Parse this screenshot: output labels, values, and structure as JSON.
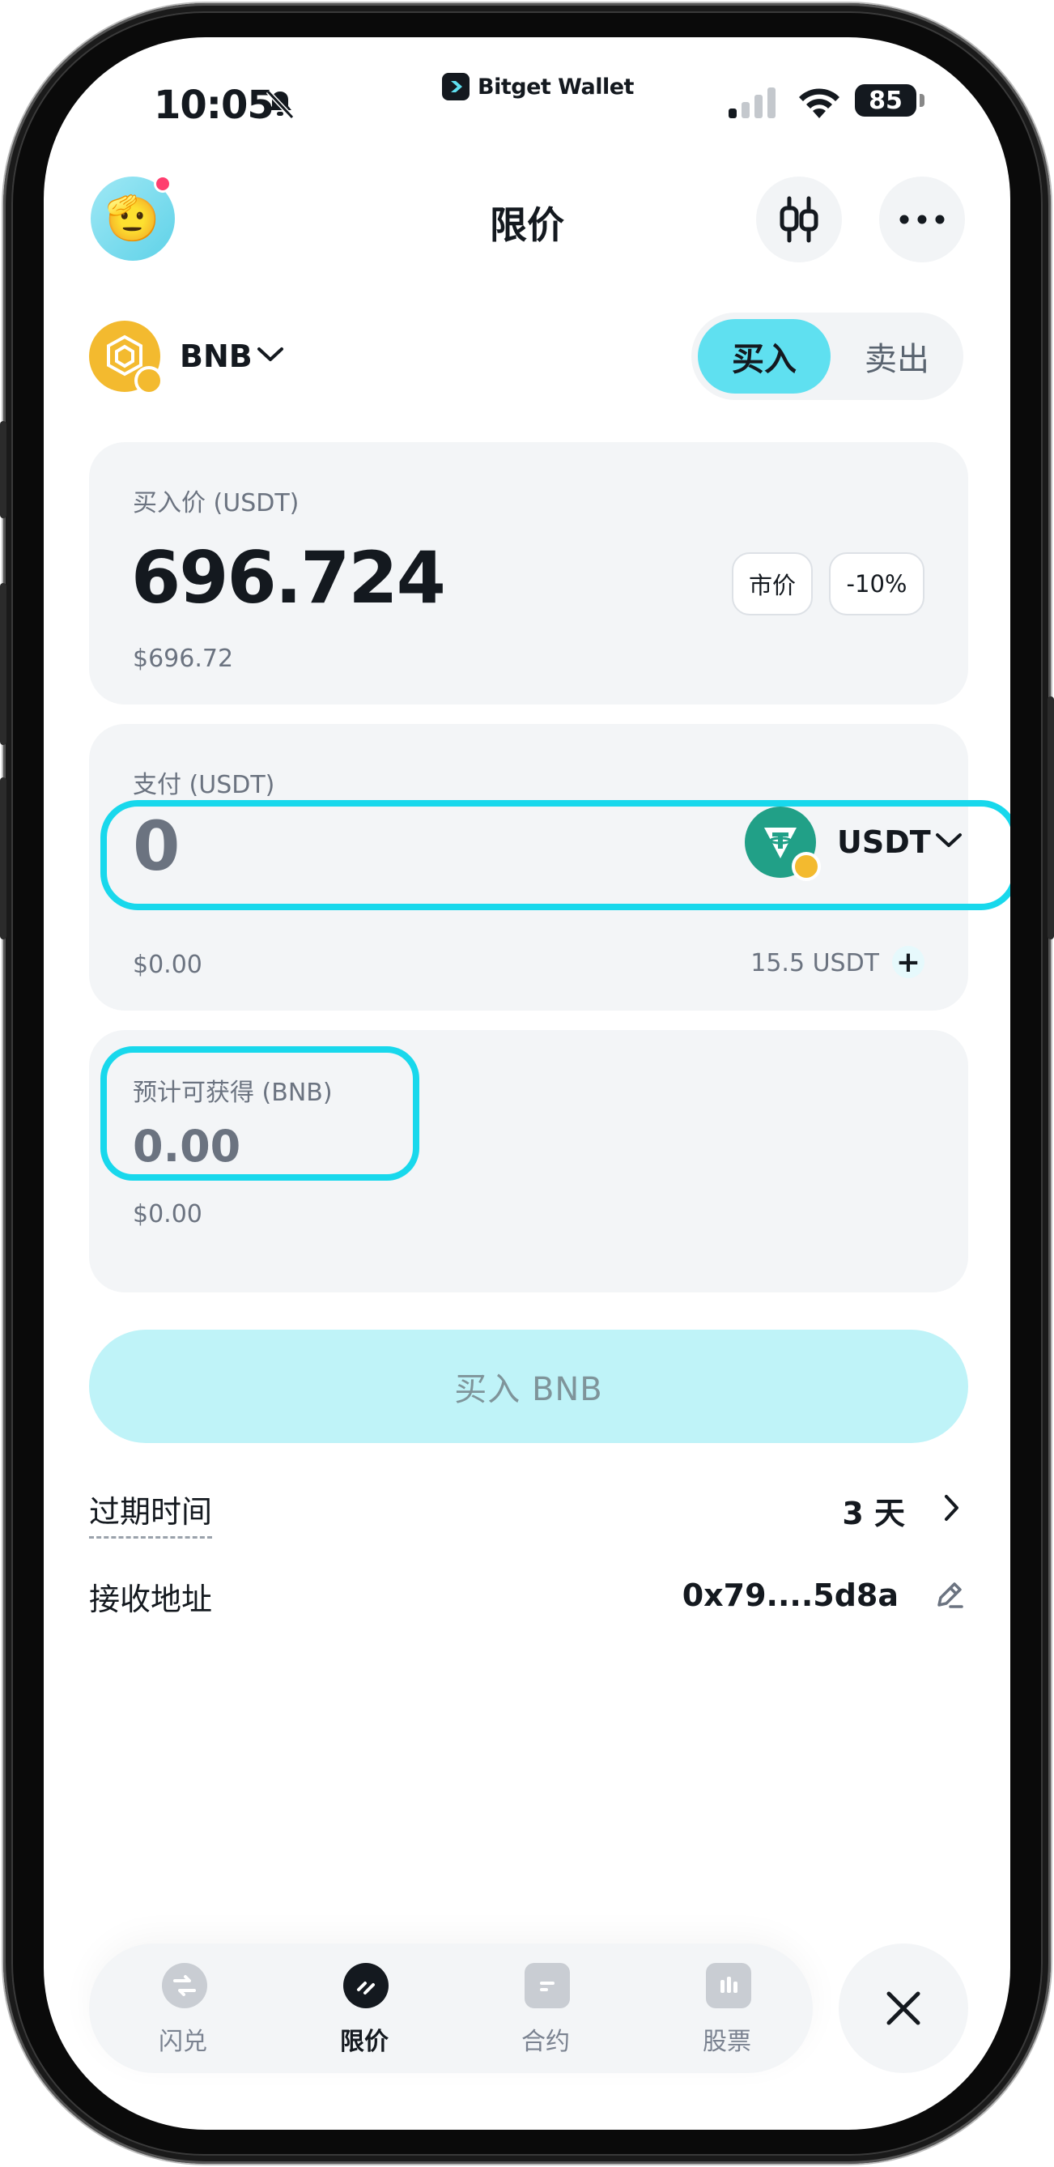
{
  "status_bar": {
    "time": "10:05",
    "brand": "Bitget Wallet",
    "battery": "85"
  },
  "header": {
    "title": "限价"
  },
  "token": {
    "symbol": "BNB"
  },
  "side_toggle": {
    "buy": "买入",
    "sell": "卖出",
    "active": "buy"
  },
  "price_card": {
    "label": "买入价 (USDT)",
    "value": "696.724",
    "usd_value": "$696.72",
    "market_button": "市价",
    "discount_button": "-10%"
  },
  "pay_card": {
    "label": "支付 (USDT)",
    "amount": "0",
    "token": "USDT",
    "usd_value": "$0.00",
    "balance": "15.5 USDT"
  },
  "receive_card": {
    "label": "预计可获得 (BNB)",
    "amount": "0.00",
    "usd_value": "$0.00"
  },
  "submit_button": "买入 BNB",
  "expiry": {
    "label": "过期时间",
    "value": "3 天"
  },
  "receive_address": {
    "label": "接收地址",
    "value": "0x79....5d8a"
  },
  "bottom_nav": {
    "items": [
      {
        "label": "闪兑",
        "icon": "swap-icon"
      },
      {
        "label": "限价",
        "icon": "limit-order-icon"
      },
      {
        "label": "合约",
        "icon": "contract-icon"
      },
      {
        "label": "股票",
        "icon": "stocks-icon"
      }
    ],
    "active": "限价"
  },
  "colors": {
    "accent": "#5fe0f0",
    "highlight": "#18d8ec",
    "card_bg": "#f3f5f7",
    "text": "#14191f",
    "muted": "#6b7380"
  }
}
